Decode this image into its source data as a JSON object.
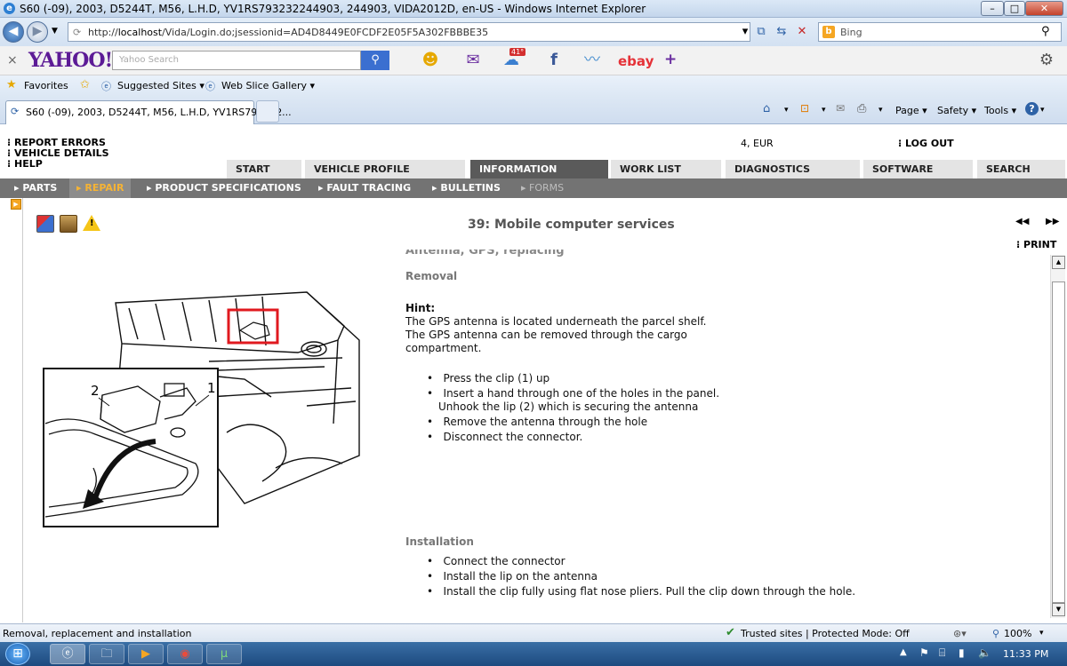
{
  "window": {
    "title": "S60 (-09), 2003, D5244T, M56, L.H.D, YV1RS793232244903, 244903, VIDA2012D, en-US - Windows Internet Explorer",
    "minimize": "–",
    "maximize": "□",
    "close": "✕"
  },
  "addressbar": {
    "url_prefix": "http://",
    "url_host": "localhost",
    "url_path": "/Vida/Login.do;jsessionid=AD4D8449E0FCDF2E05F5A302FBBBE35",
    "search_placeholder": "Bing",
    "search_logo": "b"
  },
  "yahoo": {
    "close": "×",
    "logo": "YAHOO!",
    "search_placeholder": "Yahoo Search",
    "weather_badge": "41°",
    "ebay": "ebay",
    "plus": "+"
  },
  "favorites": {
    "label": "Favorites",
    "suggested": "Suggested Sites ▾",
    "webslice": "Web Slice Gallery ▾"
  },
  "browser_tab": {
    "title": "S60 (-09), 2003, D5244T, M56, L.H.D, YV1RS793232...",
    "commands": {
      "page": "Page ▾",
      "safety": "Safety ▾",
      "tools": "Tools ▾"
    }
  },
  "vida": {
    "top_links": [
      "REPORT ERRORS",
      "VEHICLE DETAILS",
      "HELP"
    ],
    "currency": "4, EUR",
    "logout": "LOG OUT",
    "main_tabs": [
      "START",
      "VEHICLE PROFILE",
      "INFORMATION",
      "WORK LIST",
      "DIAGNOSTICS",
      "SOFTWARE",
      "SEARCH"
    ],
    "sub_nav": [
      "PARTS",
      "REPAIR",
      "PRODUCT SPECIFICATIONS",
      "FAULT TRACING",
      "BULLETINS",
      "FORMS"
    ],
    "doc_title": "39: Mobile computer services",
    "nav_prev": "◀◀",
    "nav_next": "▶▶",
    "print": "PRINT",
    "doc": {
      "cut_heading": "Antenna, GPS, replacing",
      "removal_heading": "Removal",
      "hint_label": "Hint:",
      "hint_lines": [
        "The GPS antenna is located underneath the parcel shelf.",
        "The GPS antenna can be removed through the cargo",
        "compartment."
      ],
      "removal_steps": [
        "Press the clip (1) up",
        "Insert a hand through one of the holes in the panel.",
        "Remove the antenna through the hole",
        "Disconnect the connector."
      ],
      "removal_step2_cont": "Unhook the lip (2) which is securing the antenna",
      "installation_heading": "Installation",
      "installation_steps": [
        "Connect the connector",
        "Install the lip on the antenna",
        "Install the clip fully using flat nose pliers. Pull the clip down through the hole."
      ],
      "illustration_labels": [
        "2",
        "1"
      ]
    }
  },
  "status": {
    "text": "Removal, replacement and installation",
    "zone": "Trusted sites | Protected Mode: Off",
    "zoom": "100%"
  },
  "taskbar": {
    "time": "11:33 PM"
  },
  "colors": {
    "active_tab": "#5a5a5a",
    "subnav_bg": "#737373",
    "subnav_active_text": "#f5b335",
    "highlight_box": "#e0191f"
  }
}
